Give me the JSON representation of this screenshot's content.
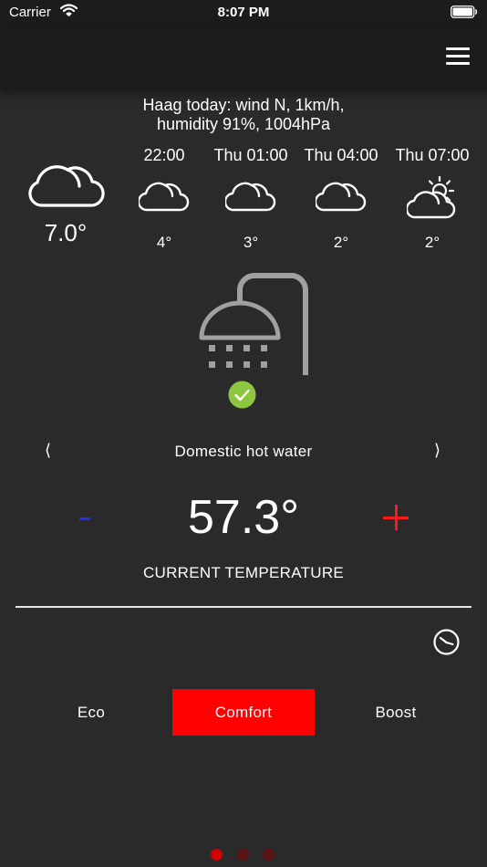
{
  "status_bar": {
    "carrier": "Carrier",
    "time": "8:07 PM"
  },
  "weather": {
    "summary_line1": "Haag today: wind N, 1km/h,",
    "summary_line2": "humidity 91%, 1004hPa",
    "current": {
      "temp": "7.0°",
      "icon": "cloud-icon"
    },
    "forecast": [
      {
        "time": "22:00",
        "temp": "4°",
        "icon": "cloud-icon"
      },
      {
        "time": "Thu 01:00",
        "temp": "3°",
        "icon": "cloud-icon"
      },
      {
        "time": "Thu 04:00",
        "temp": "2°",
        "icon": "cloud-icon"
      },
      {
        "time": "Thu 07:00",
        "temp": "2°",
        "icon": "partly-sunny-icon"
      }
    ]
  },
  "device": {
    "prev_arrow": "⟨",
    "next_arrow": "⟩",
    "name": "Domestic hot water",
    "icon": "shower-icon",
    "status_icon": "check-icon"
  },
  "temperature": {
    "value": "57.3°",
    "label": "CURRENT TEMPERATURE"
  },
  "modes": {
    "eco": "Eco",
    "comfort": "Comfort",
    "boost": "Boost",
    "selected": "Comfort"
  },
  "colors": {
    "background": "#2a2a2a",
    "bar": "#1c1c1c",
    "accent_red": "#ff0000",
    "minus_blue": "#1f32e8",
    "check_green": "#8dc63f",
    "shower_grey": "#a0a0a0"
  },
  "pager": {
    "pages": 3,
    "current": 1
  }
}
